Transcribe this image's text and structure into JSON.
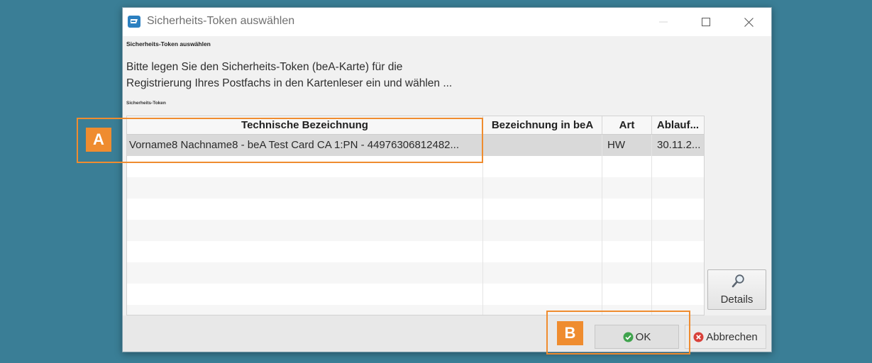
{
  "window": {
    "title": "Sicherheits-Token auswählen"
  },
  "dialog": {
    "heading": "Sicherheits-Token auswählen",
    "instruction_lines": [
      "Bitte legen Sie den Sicherheits-Token (beA-Karte) für die",
      "Registrierung Ihres Postfachs in den Kartenleser ein und wählen ..."
    ],
    "list_label": "Sicherheits-Token"
  },
  "token_table": {
    "columns": [
      "Technische Bezeichnung",
      "Bezeichnung in beA",
      "Art",
      "Ablauf..."
    ],
    "rows": [
      {
        "technische_bezeichnung": "Vorname8 Nachname8 - beA Test Card CA 1:PN - 44976306812482...",
        "art": "HW",
        "ablauf": "30.11.2...",
        "selected": true
      }
    ]
  },
  "buttons": {
    "details": "Details",
    "ok": "OK",
    "cancel": "Abbrechen"
  },
  "annotations": {
    "a": "A",
    "b": "B"
  },
  "icons": {
    "app": "token-app-icon",
    "minimize": "minimize-icon",
    "maximize": "maximize-icon",
    "close": "close-icon",
    "details": "magnifier-icon",
    "ok": "check-circle-icon",
    "cancel": "cross-circle-icon"
  },
  "colors": {
    "desktop_background": "#3a7e96",
    "annotation": "#ef8c2f",
    "selected_row": "#d9d9d9",
    "ok_icon": "#3fa34d",
    "cancel_icon": "#d8413a"
  }
}
